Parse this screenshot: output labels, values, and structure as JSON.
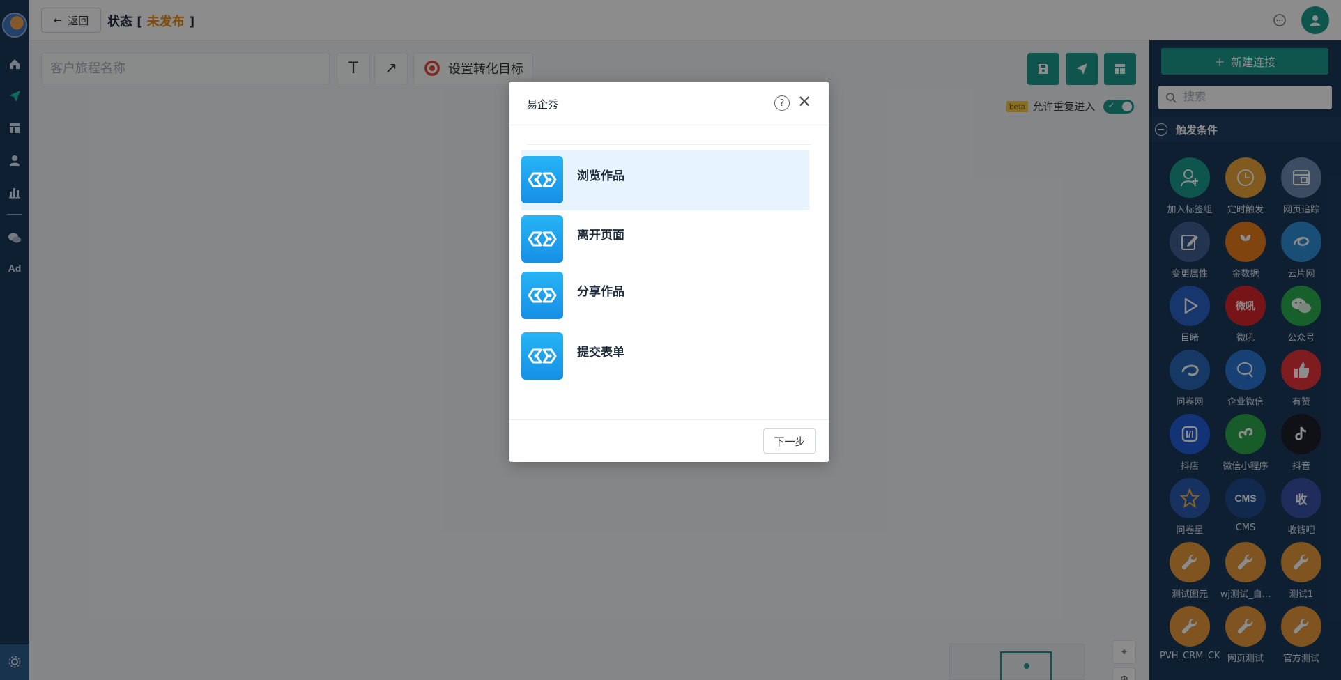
{
  "topbar": {
    "back_label": "返回",
    "status_prefix": "状态 [ ",
    "status_value": "未发布",
    "status_suffix": " ]"
  },
  "toolbar": {
    "name_placeholder": "客户旅程名称",
    "text_tool": "T",
    "arrow_tool": "↗",
    "goal_label": "设置转化目标",
    "beta_badge": "beta",
    "allow_reentry_label": "允许重复进入",
    "allow_reentry_on": true
  },
  "nav": {
    "ad_label": "Ad"
  },
  "panel": {
    "new_connection_label": "新建连接",
    "search_placeholder": "搜索",
    "section_title": "触发条件",
    "items": [
      {
        "label": "加入标签组",
        "icon": "user-plus-icon",
        "color": "#1a9c8e",
        "glyph": ""
      },
      {
        "label": "定时触发",
        "icon": "clock-icon",
        "color": "#e9a43a",
        "glyph": ""
      },
      {
        "label": "网页追踪",
        "icon": "webpage-icon",
        "color": "#6d8bb3",
        "glyph": ""
      },
      {
        "label": "变更属性",
        "icon": "edit-icon",
        "color": "#3f5f93",
        "glyph": ""
      },
      {
        "label": "金数据",
        "icon": "jinshuju-icon",
        "color": "#e97c1c",
        "glyph": ""
      },
      {
        "label": "云片网",
        "icon": "yunpian-icon",
        "color": "#2f8fd8",
        "glyph": ""
      },
      {
        "label": "目睹",
        "icon": "play-icon",
        "color": "#2a63c9",
        "glyph": ""
      },
      {
        "label": "微吼",
        "icon": "weihou-icon",
        "color": "#d9262a",
        "glyph": "微吼"
      },
      {
        "label": "公众号",
        "icon": "wechat-icon",
        "color": "#2aae4f",
        "glyph": ""
      },
      {
        "label": "问卷网",
        "icon": "wenjuan-icon",
        "color": "#2766b8",
        "glyph": ""
      },
      {
        "label": "企业微信",
        "icon": "wecom-icon",
        "color": "#2b76d4",
        "glyph": ""
      },
      {
        "label": "有赞",
        "icon": "thumbs-up-icon",
        "color": "#e8333a",
        "glyph": ""
      },
      {
        "label": "抖店",
        "icon": "doudian-icon",
        "color": "#2160d8",
        "glyph": ""
      },
      {
        "label": "微信小程序",
        "icon": "miniprogram-icon",
        "color": "#2aa84b",
        "glyph": ""
      },
      {
        "label": "抖音",
        "icon": "tiktok-icon",
        "color": "#1e1e2a",
        "glyph": ""
      },
      {
        "label": "问卷星",
        "icon": "star-icon",
        "color": "#2a5ab0",
        "glyph": ""
      },
      {
        "label": "CMS",
        "icon": "cms-icon",
        "color": "#1f4c8a",
        "glyph": "CMS"
      },
      {
        "label": "收钱吧",
        "icon": "shouqianba-icon",
        "color": "#3a52a8",
        "glyph": "收"
      },
      {
        "label": "测试图元",
        "icon": "wrench-icon",
        "color": "#e89a3c",
        "glyph": ""
      },
      {
        "label": "wj测试_自...",
        "icon": "wrench-icon",
        "color": "#e89a3c",
        "glyph": ""
      },
      {
        "label": "测试1",
        "icon": "wrench-icon",
        "color": "#e89a3c",
        "glyph": ""
      },
      {
        "label": "PVH_CRM_CK",
        "icon": "wrench-icon",
        "color": "#e89a3c",
        "glyph": ""
      },
      {
        "label": "网页测试",
        "icon": "wrench-icon",
        "color": "#e89a3c",
        "glyph": ""
      },
      {
        "label": "官方测试",
        "icon": "wrench-icon",
        "color": "#e89a3c",
        "glyph": ""
      }
    ]
  },
  "modal": {
    "title": "易企秀",
    "events": [
      {
        "label": "浏览作品",
        "selected": true
      },
      {
        "label": "离开页面",
        "selected": false
      },
      {
        "label": "分享作品",
        "selected": false
      },
      {
        "label": "提交表单",
        "selected": false
      }
    ],
    "next_label": "下一步"
  },
  "colors": {
    "accent": "#1d9c8c",
    "nav_bg": "#1c3a5c",
    "status_orange": "#e8890c",
    "selected_row": "#e8f4fd"
  }
}
